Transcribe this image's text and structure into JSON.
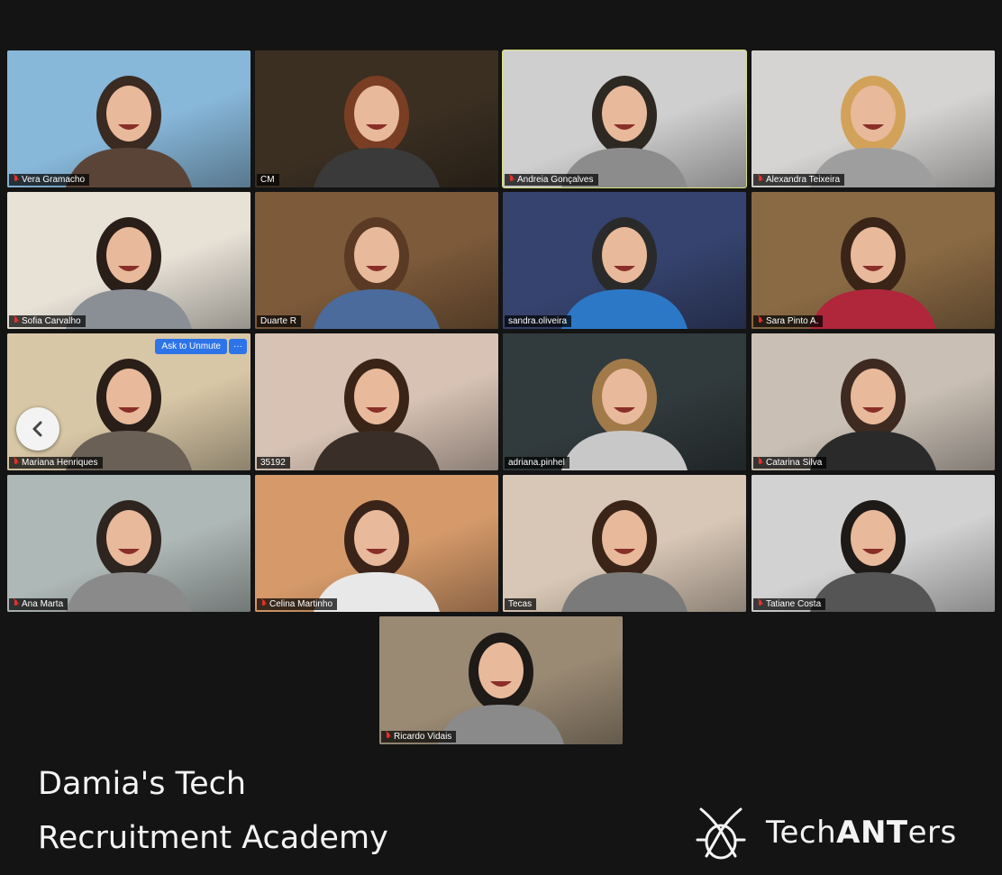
{
  "participants": [
    {
      "name": "Vera Gramacho",
      "bg": "#87b7d9",
      "shirt": "#5a4438",
      "hair": "#3a2a22",
      "muted": true
    },
    {
      "name": "CM",
      "bg": "#3b2f22",
      "shirt": "#3a3a3a",
      "hair": "#7a3e25",
      "muted": false
    },
    {
      "name": "Andreia Gonçalves",
      "bg": "#cfcfcf",
      "shirt": "#8c8c8c",
      "hair": "#2e2822",
      "muted": true,
      "active": true
    },
    {
      "name": "Alexandra Teixeira",
      "bg": "#d6d4d2",
      "shirt": "#9e9e9e",
      "hair": "#d2a25a",
      "muted": true
    },
    {
      "name": "Sofia Carvalho",
      "bg": "#e7e1d6",
      "shirt": "#8a8f96",
      "hair": "#2a1e18",
      "muted": true
    },
    {
      "name": "Duarte R",
      "bg": "#7d5a3a",
      "shirt": "#4a6b9c",
      "hair": "#5a3a24",
      "muted": false
    },
    {
      "name": "sandra.oliveira",
      "bg": "#36436e",
      "shirt": "#2d78c6",
      "hair": "#2a2a2a",
      "muted": false
    },
    {
      "name": "Sara Pinto A.",
      "bg": "#8a6a44",
      "shirt": "#b0263a",
      "hair": "#3a2418",
      "muted": true
    },
    {
      "name": "Mariana Henriques",
      "bg": "#d8c7a6",
      "shirt": "#6a6056",
      "hair": "#2a1e18",
      "muted": true,
      "ask_unmute": true
    },
    {
      "name": "35192",
      "bg": "#d7c2b4",
      "shirt": "#3a2e28",
      "hair": "#3a2418",
      "muted": false
    },
    {
      "name": "adriana.pinhel",
      "bg": "#313a3c",
      "shirt": "#c8c8c8",
      "hair": "#a27a4a",
      "muted": false
    },
    {
      "name": "Catarina Silva",
      "bg": "#c9bfb4",
      "shirt": "#2a2a2a",
      "hair": "#3e2a20",
      "muted": true
    },
    {
      "name": "Ana Marta",
      "bg": "#aeb8b6",
      "shirt": "#8a8a8a",
      "hair": "#2e2420",
      "muted": true
    },
    {
      "name": "Celina Martinho",
      "bg": "#d69a6a",
      "shirt": "#e8e8e8",
      "hair": "#3a241a",
      "muted": true
    },
    {
      "name": "Tecas",
      "bg": "#d8c7b6",
      "shirt": "#7a7a7a",
      "hair": "#3a2418",
      "muted": false
    },
    {
      "name": "Tatiane Costa",
      "bg": "#d2d2d2",
      "shirt": "#555555",
      "hair": "#1e1a18",
      "muted": true
    },
    {
      "name": "Ricardo Vidais",
      "bg": "#9a8a74",
      "shirt": "#8a8a8a",
      "hair": "#1e1a18",
      "muted": true
    }
  ],
  "controls": {
    "ask_to_unmute": "Ask to Unmute",
    "more": "···",
    "prev_icon": "chevron-left-icon"
  },
  "footer": {
    "title_line1": "Damia's Tech",
    "title_line2": "Recruitment Academy",
    "brand_prefix": "Tech",
    "brand_bold": "ANT",
    "brand_suffix": "ers"
  },
  "colors": {
    "active_speaker": "#d9e27a",
    "muted_mic": "#e5322d",
    "unmute_button": "#2d74e8"
  }
}
